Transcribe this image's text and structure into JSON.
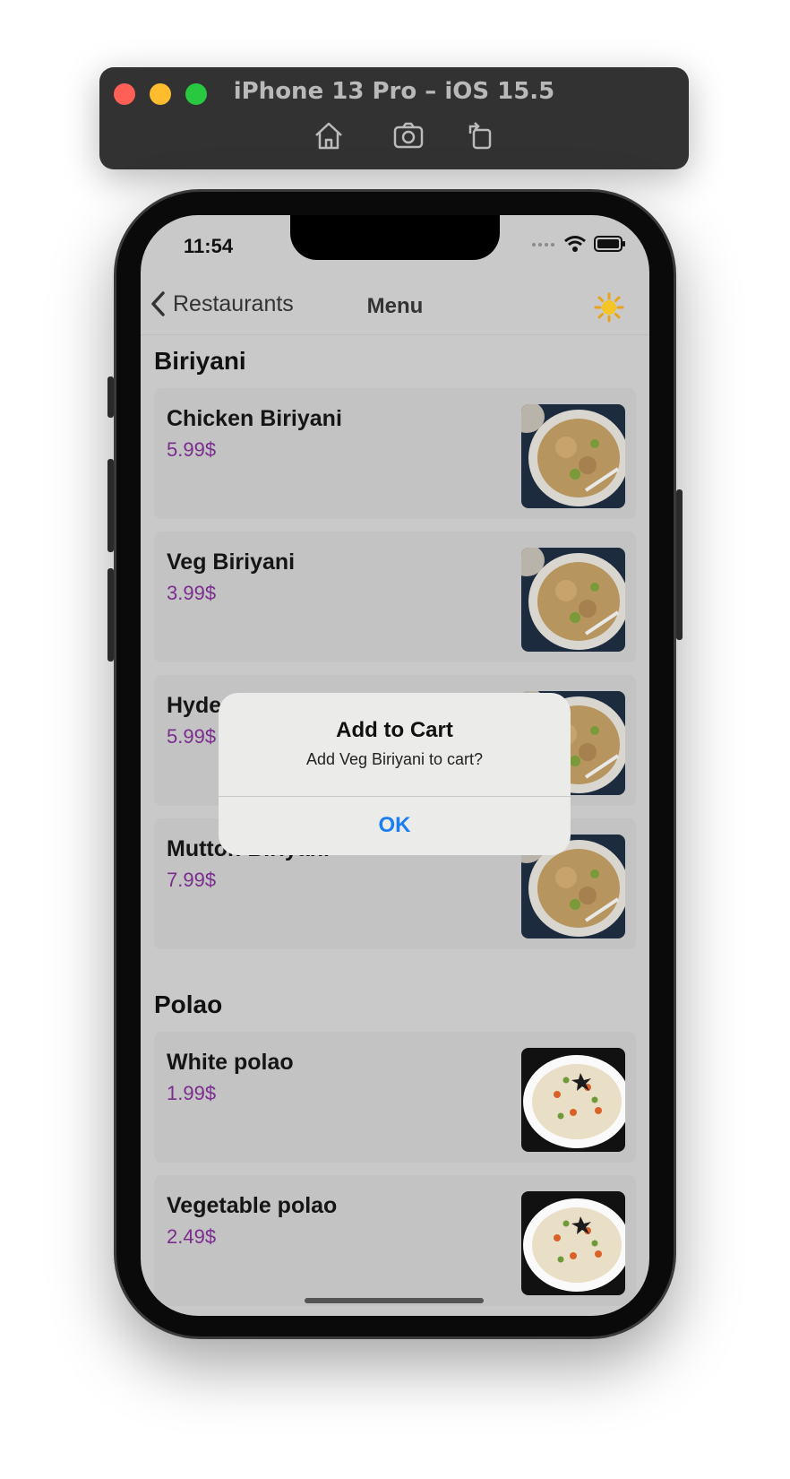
{
  "simulator": {
    "title": "iPhone 13 Pro – iOS 15.5",
    "buttons": [
      "home-icon",
      "screenshot-icon",
      "rotate-icon"
    ]
  },
  "status": {
    "time": "11:54"
  },
  "nav": {
    "back_label": "Restaurants",
    "title": "Menu",
    "theme_icon": "sun-icon"
  },
  "sections": [
    {
      "title": "Biriyani",
      "items": [
        {
          "name": "Chicken Biriyani",
          "price": "5.99$"
        },
        {
          "name": "Veg Biriyani",
          "price": "3.99$"
        },
        {
          "name": "Hyde",
          "price": "5.99$"
        },
        {
          "name": "Mutton Biriyani",
          "price": "7.99$"
        }
      ]
    },
    {
      "title": "Polao",
      "items": [
        {
          "name": "White polao",
          "price": "1.99$"
        },
        {
          "name": "Vegetable polao",
          "price": "2.49$"
        }
      ]
    }
  ],
  "alert": {
    "title": "Add to Cart",
    "message": "Add Veg Biriyani to cart?",
    "ok_label": "OK"
  },
  "colors": {
    "price": "#7b2c8f",
    "accent": "#1a7ef0"
  }
}
